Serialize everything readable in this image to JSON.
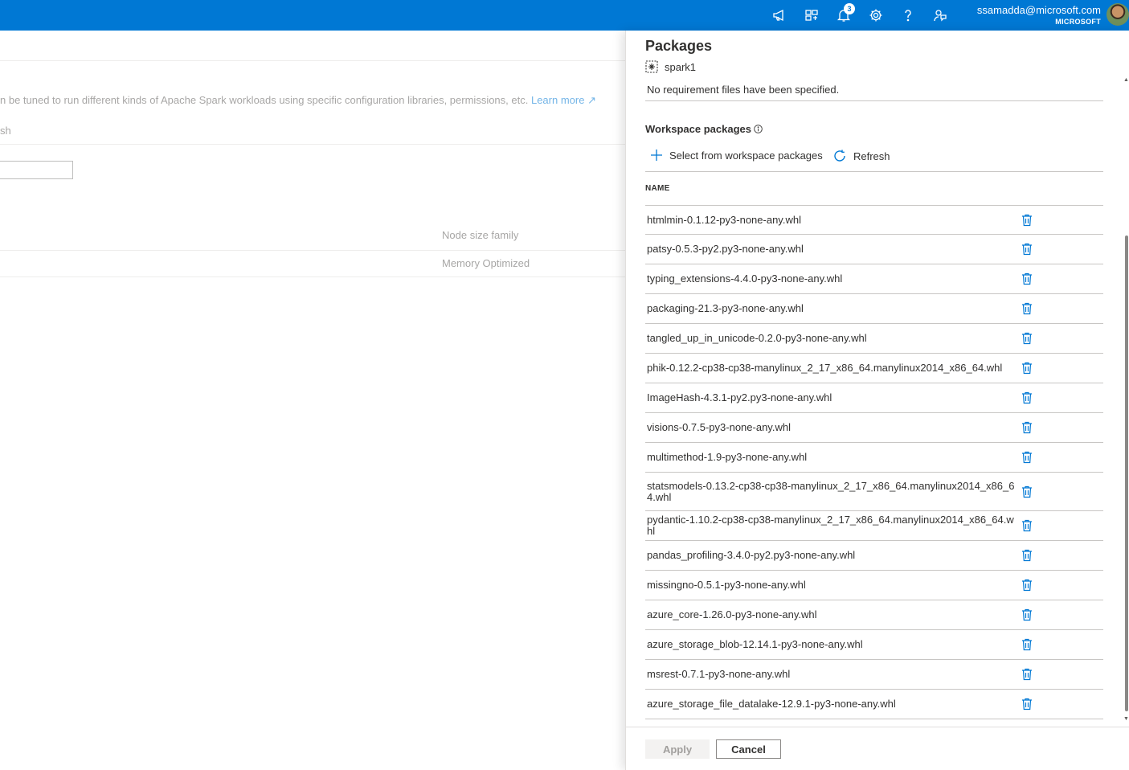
{
  "topbar": {
    "notification_count": "3",
    "account_email": "ssamadda@microsoft.com",
    "account_org": "MICROSOFT",
    "icons": [
      "announcement-icon",
      "directory-switch-icon",
      "notifications-icon",
      "settings-icon",
      "help-icon",
      "feedback-icon"
    ],
    "accent_color": "#0078d4"
  },
  "background": {
    "description_text": "n be tuned to run different kinds of Apache Spark workloads using specific configuration libraries, permissions, etc.",
    "learn_more": "Learn more",
    "refresh_fragment": "sh",
    "column_header": "Node size family",
    "cell_value": "Memory Optimized"
  },
  "panel": {
    "title": "Packages",
    "pool_name": "spark1",
    "requirements_text": "No requirement files have been specified.",
    "workspace_section_title": "Workspace packages",
    "select_button": "Select from workspace packages",
    "refresh_button": "Refresh",
    "column_name": "NAME",
    "packages": [
      "htmlmin-0.1.12-py3-none-any.whl",
      "patsy-0.5.3-py2.py3-none-any.whl",
      "typing_extensions-4.4.0-py3-none-any.whl",
      "packaging-21.3-py3-none-any.whl",
      "tangled_up_in_unicode-0.2.0-py3-none-any.whl",
      "phik-0.12.2-cp38-cp38-manylinux_2_17_x86_64.manylinux2014_x86_64.whl",
      "ImageHash-4.3.1-py2.py3-none-any.whl",
      "visions-0.7.5-py3-none-any.whl",
      "multimethod-1.9-py3-none-any.whl",
      "statsmodels-0.13.2-cp38-cp38-manylinux_2_17_x86_64.manylinux2014_x86_64.whl",
      "pydantic-1.10.2-cp38-cp38-manylinux_2_17_x86_64.manylinux2014_x86_64.whl",
      "pandas_profiling-3.4.0-py2.py3-none-any.whl",
      "missingno-0.5.1-py3-none-any.whl",
      "azure_core-1.26.0-py3-none-any.whl",
      "azure_storage_blob-12.14.1-py3-none-any.whl",
      "msrest-0.7.1-py3-none-any.whl",
      "azure_storage_file_datalake-12.9.1-py3-none-any.whl"
    ],
    "apply_button": "Apply",
    "cancel_button": "Cancel"
  }
}
